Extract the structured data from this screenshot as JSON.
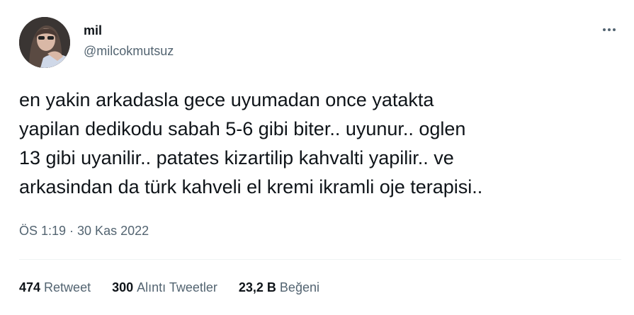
{
  "user": {
    "display_name": "mil",
    "handle": "@milcokmutsuz"
  },
  "tweet": {
    "text": "en yakin arkadasla gece uyumadan once yatakta\nyapilan dedikodu sabah 5-6 gibi biter.. uyunur.. oglen\n13 gibi uyanilir.. patates kizartilip kahvalti yapilir.. ve\narkasindan da türk kahveli el kremi ikramli oje terapisi..",
    "timestamp": "ÖS 1:19 · 30 Kas 2022"
  },
  "stats": [
    {
      "count": "474",
      "label": "Retweet"
    },
    {
      "count": "300",
      "label": "Alıntı Tweetler"
    },
    {
      "count": "23,2 B",
      "label": "Beğeni"
    }
  ],
  "icons": {
    "more": "more-options-icon"
  }
}
